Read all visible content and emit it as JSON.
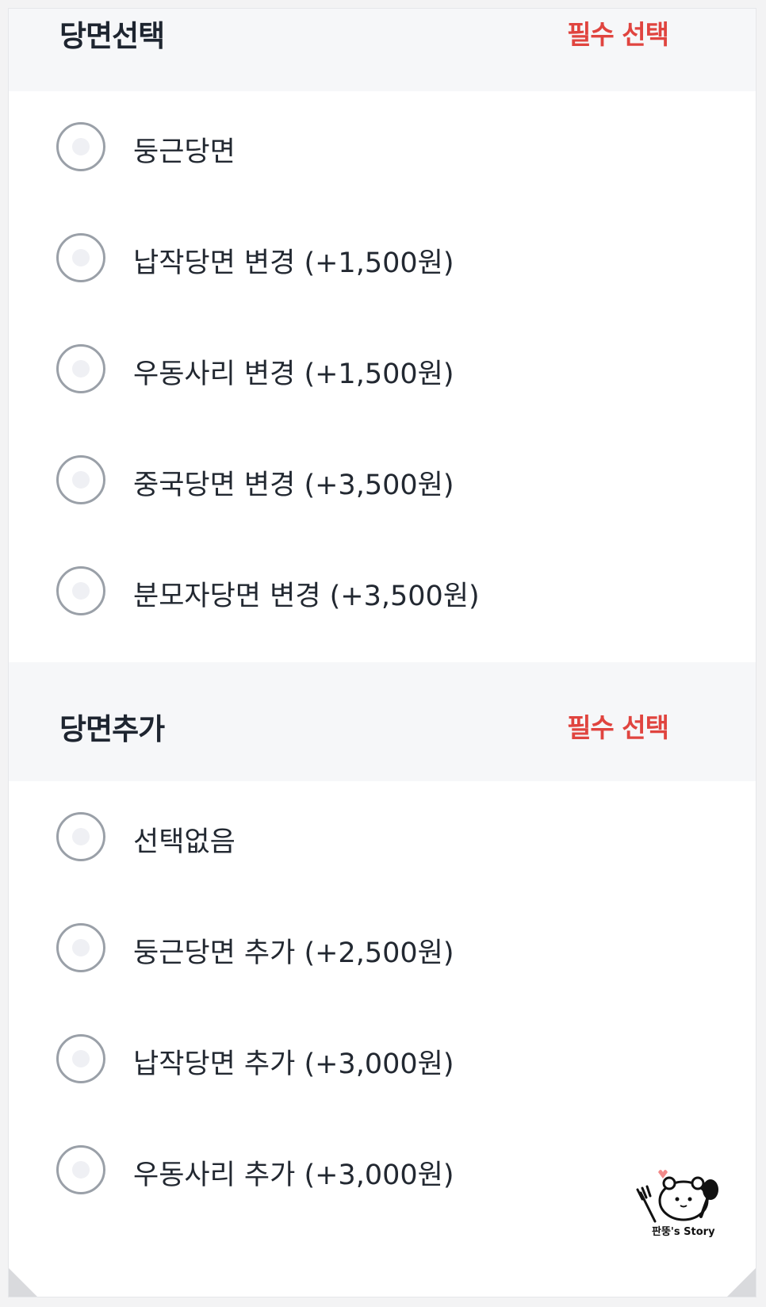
{
  "sections": [
    {
      "title": "당면선택",
      "required": "필수 선택",
      "options": [
        "둥근당면",
        "납작당면 변경 (+1,500원)",
        "우동사리 변경 (+1,500원)",
        "중국당면 변경 (+3,500원)",
        "분모자당면 변경 (+3,500원)"
      ]
    },
    {
      "title": "당면추가",
      "required": "필수 선택",
      "options": [
        "선택없음",
        "둥근당면 추가 (+2,500원)",
        "납작당면 추가 (+3,000원)",
        "우동사리 추가 (+3,000원)"
      ]
    }
  ],
  "watermark": {
    "text": "판뚱's Story"
  },
  "colors": {
    "required": "#e0443f",
    "header_bg": "#f6f7f9",
    "radio_border": "#9aa0a8"
  }
}
